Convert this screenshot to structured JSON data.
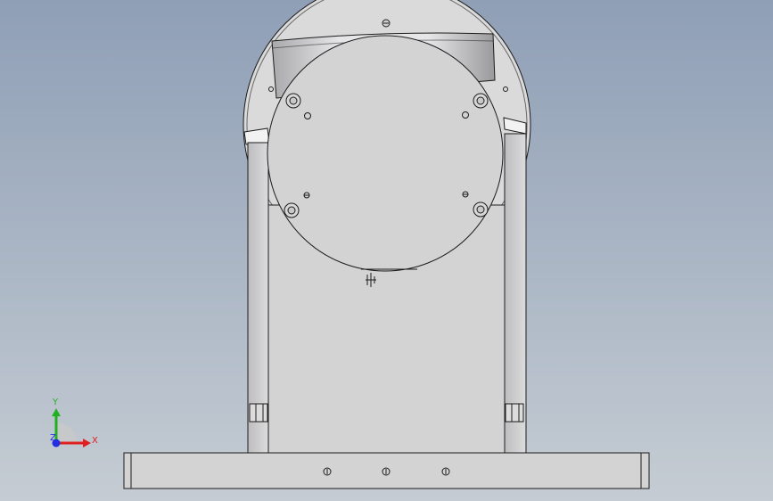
{
  "viewport": {
    "background_top": "#8f9fb6",
    "background_bottom": "#c5ccd3",
    "model_face_color": "#d3d3d4",
    "edge_color": "#1c1c1c"
  },
  "triad": {
    "x_label": "X",
    "y_label": "Y",
    "z_label": "Z",
    "x_color": "#e02020",
    "y_color": "#20b020",
    "z_color": "#2030e0"
  }
}
